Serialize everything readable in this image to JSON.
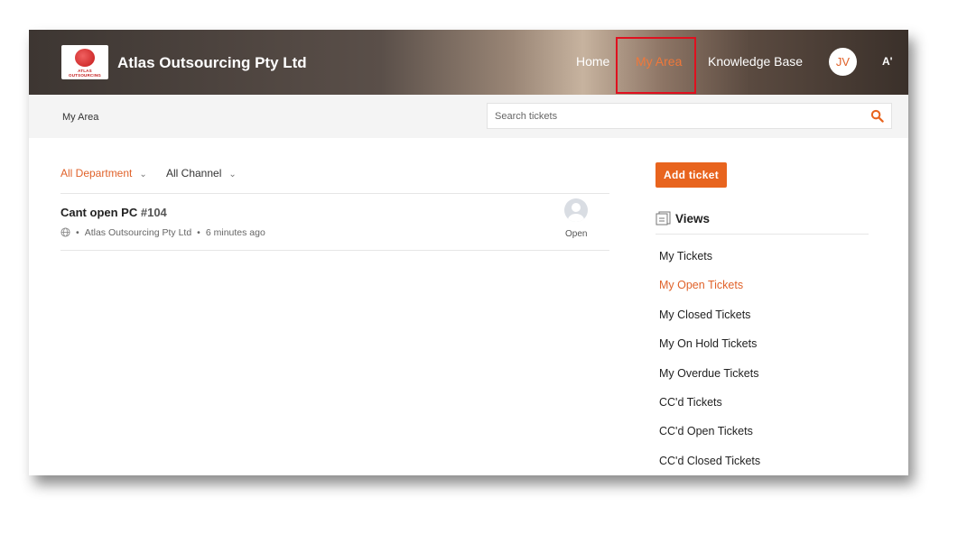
{
  "header": {
    "brand": "Atlas Outsourcing Pty Ltd",
    "logo_text": "ATLAS OUTSOURCING",
    "nav": {
      "home": "Home",
      "my_area": "My Area",
      "knowledge_base": "Knowledge Base"
    },
    "avatar_initials": "JV",
    "font_icon": "A'"
  },
  "subbar": {
    "breadcrumb": "My Area",
    "search_placeholder": "Search tickets"
  },
  "filters": {
    "department": "All Department",
    "channel": "All Channel"
  },
  "tickets": [
    {
      "title": "Cant open PC",
      "number": "#104",
      "organization": "Atlas Outsourcing Pty Ltd",
      "time": "6 minutes ago",
      "status": "Open"
    }
  ],
  "sidebar": {
    "add_ticket": "Add ticket",
    "views_title": "Views",
    "views": [
      {
        "label": "My Tickets"
      },
      {
        "label": "My Open Tickets"
      },
      {
        "label": "My Closed Tickets"
      },
      {
        "label": "My On Hold Tickets"
      },
      {
        "label": "My Overdue Tickets"
      },
      {
        "label": "CC'd Tickets"
      },
      {
        "label": "CC'd Open Tickets"
      },
      {
        "label": "CC'd Closed Tickets"
      }
    ]
  },
  "colors": {
    "accent": "#e8641e",
    "highlight_box": "#e0101f"
  },
  "icons": [
    "search-icon",
    "chevron-down-icon",
    "globe-icon",
    "user-avatar-icon",
    "views-icon"
  ]
}
